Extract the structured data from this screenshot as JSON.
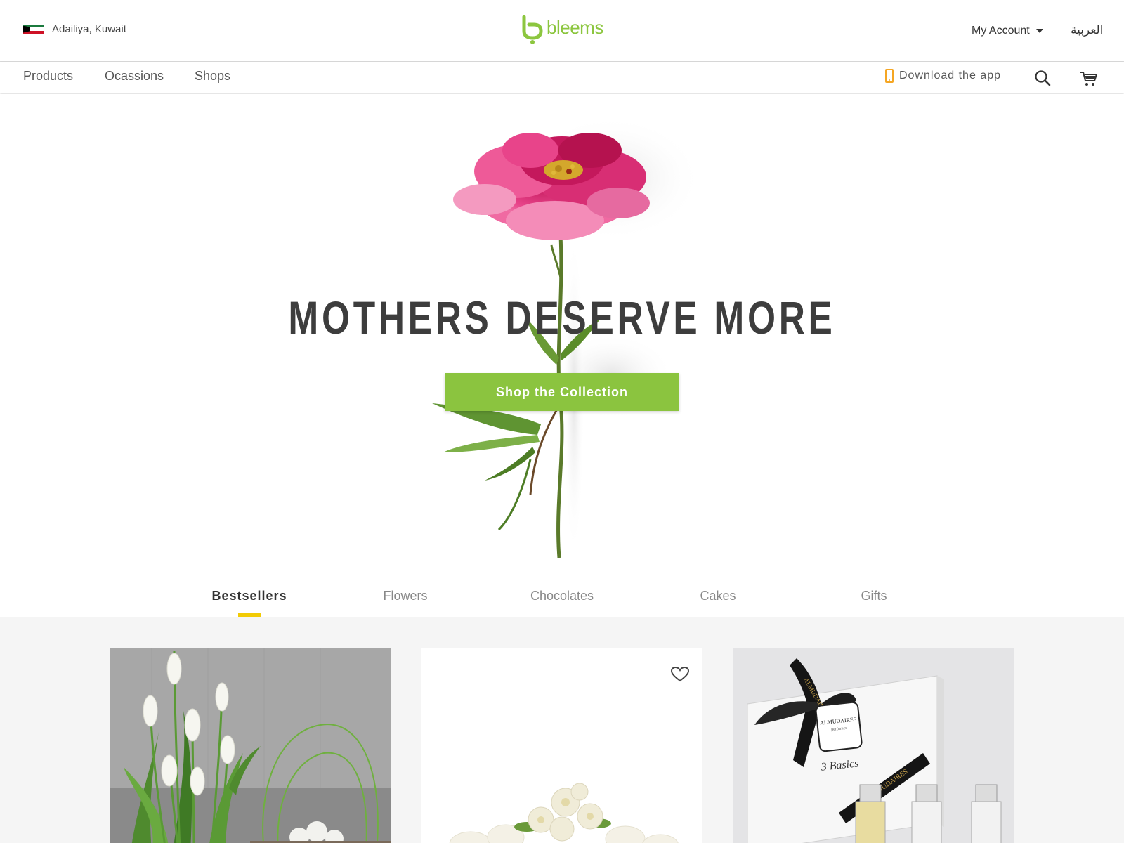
{
  "header": {
    "location": "Adailiya, Kuwait",
    "flag_icon": "kuwait-flag-icon",
    "logo_text": "bleems",
    "account_label": "My Account",
    "language_label": "العربية"
  },
  "nav": {
    "items": [
      {
        "label": "Products"
      },
      {
        "label": "Ocassions"
      },
      {
        "label": "Shops"
      }
    ],
    "download_app_label": "Download the app",
    "search_icon": "search-icon",
    "cart_icon": "cart-icon"
  },
  "hero": {
    "title": "MOTHERS DESERVE MORE",
    "cta_label": "Shop the Collection"
  },
  "tabs": [
    {
      "label": "Bestsellers",
      "active": true
    },
    {
      "label": "Flowers",
      "active": false
    },
    {
      "label": "Chocolates",
      "active": false
    },
    {
      "label": "Cakes",
      "active": false
    },
    {
      "label": "Gifts",
      "active": false
    }
  ],
  "products": {
    "card3": {
      "brand": "ALMUDAIRES",
      "brand_sub": "perfumes",
      "box_label": "3 Basics"
    }
  },
  "colors": {
    "brand_green": "#8bc43f",
    "tab_indicator": "#f2cb05",
    "app_icon": "#f5a623",
    "background_gray": "#f5f5f5"
  }
}
